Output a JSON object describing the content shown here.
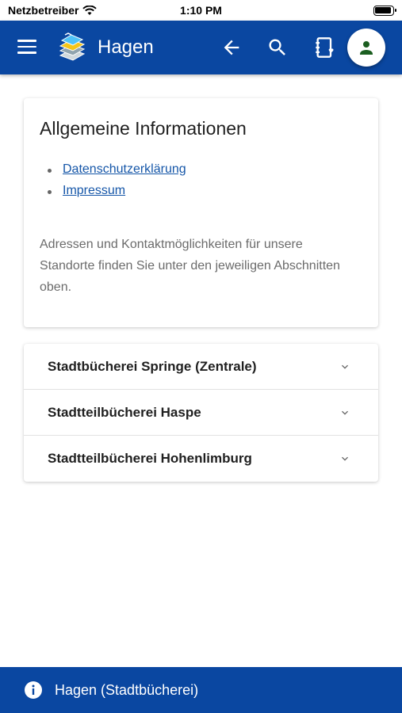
{
  "status": {
    "carrier": "Netzbetreiber",
    "time": "1:10 PM"
  },
  "appbar": {
    "title": "Hagen",
    "icons": [
      "menu-icon",
      "library-logo",
      "arrow-back-icon",
      "search-icon",
      "library-card-icon",
      "account-icon"
    ]
  },
  "colors": {
    "primary": "#0a47a1",
    "link": "#1556a8",
    "avatar_fg": "#1b5e20"
  },
  "info": {
    "heading": "Allgemeine Informationen",
    "links": [
      "Datenschutzerklärung",
      "Impressum"
    ],
    "text": "Adressen und Kontaktmöglichkeiten für unsere Standorte finden Sie unter den jeweiligen Abschnitten oben."
  },
  "locations": [
    {
      "name": "Stadtbücherei Springe (Zentrale)"
    },
    {
      "name": "Stadtteilbücherei Haspe"
    },
    {
      "name": "Stadtteilbücherei Hohenlimburg"
    }
  ],
  "bottombar": {
    "label": "Hagen (Stadtbücherei)"
  }
}
